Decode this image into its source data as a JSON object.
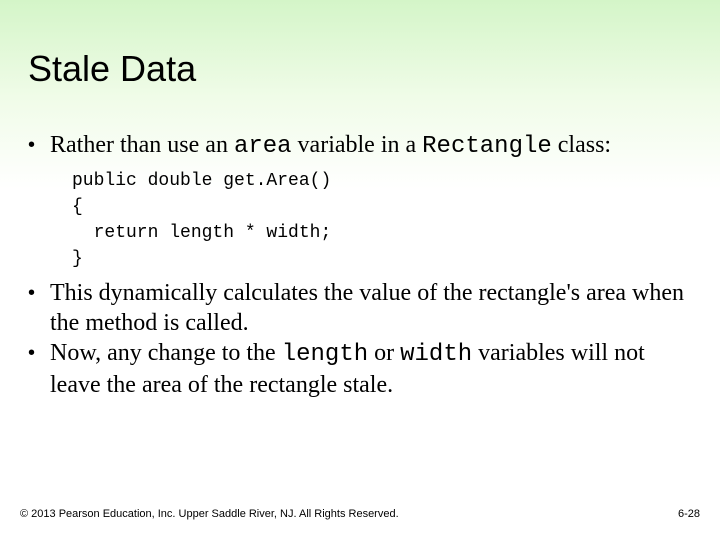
{
  "title": "Stale Data",
  "bullets": {
    "b1_pre": "Rather than use an ",
    "b1_code1": "area",
    "b1_mid": " variable in a ",
    "b1_code2": "Rectangle",
    "b1_post": " class:",
    "code_l1": "public double get.Area()",
    "code_l2": "{",
    "code_l3": "  return length * width;",
    "code_l4": "}",
    "b2": "This dynamically calculates the value of the rectangle's area when the method is called.",
    "b3_pre": "Now, any change to the ",
    "b3_code1": "length",
    "b3_mid": " or ",
    "b3_code2": "width",
    "b3_post": " variables will not leave the area of the rectangle stale."
  },
  "footer": {
    "left": "© 2013 Pearson Education, Inc. Upper Saddle River, NJ. All Rights Reserved.",
    "right": "6-28"
  }
}
